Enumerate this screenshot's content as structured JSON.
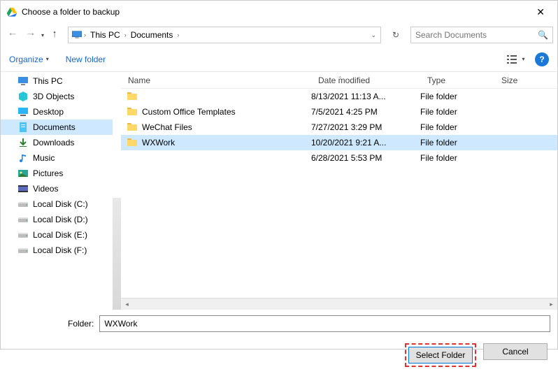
{
  "window": {
    "title": "Choose a folder to backup"
  },
  "address": {
    "segments": [
      "This PC",
      "Documents"
    ]
  },
  "search": {
    "placeholder": "Search Documents"
  },
  "toolbar": {
    "organize": "Organize",
    "newfolder": "New folder"
  },
  "columns": {
    "name": "Name",
    "date": "Date modified",
    "type": "Type",
    "size": "Size"
  },
  "sidebar": {
    "items": [
      {
        "label": "This PC",
        "icon": "pc"
      },
      {
        "label": "3D Objects",
        "icon": "3d"
      },
      {
        "label": "Desktop",
        "icon": "desktop"
      },
      {
        "label": "Documents",
        "icon": "docs",
        "selected": true
      },
      {
        "label": "Downloads",
        "icon": "down"
      },
      {
        "label": "Music",
        "icon": "music"
      },
      {
        "label": "Pictures",
        "icon": "pics"
      },
      {
        "label": "Videos",
        "icon": "vids"
      },
      {
        "label": "Local Disk (C:)",
        "icon": "disk"
      },
      {
        "label": "Local Disk (D:)",
        "icon": "disk"
      },
      {
        "label": "Local Disk (E:)",
        "icon": "disk"
      },
      {
        "label": "Local Disk (F:)",
        "icon": "disk"
      }
    ]
  },
  "rows": [
    {
      "name": "",
      "date": "8/13/2021 11:13 A...",
      "type": "File folder"
    },
    {
      "name": "Custom Office Templates",
      "date": "7/5/2021 4:25 PM",
      "type": "File folder"
    },
    {
      "name": "WeChat Files",
      "date": "7/27/2021 3:29 PM",
      "type": "File folder"
    },
    {
      "name": "WXWork",
      "date": "10/20/2021 9:21 A...",
      "type": "File folder",
      "selected": true
    },
    {
      "name": "",
      "date": "6/28/2021 5:53 PM",
      "type": "File folder",
      "noicon": true
    }
  ],
  "folder": {
    "label": "Folder:",
    "value": "WXWork"
  },
  "buttons": {
    "select": "Select Folder",
    "cancel": "Cancel"
  }
}
